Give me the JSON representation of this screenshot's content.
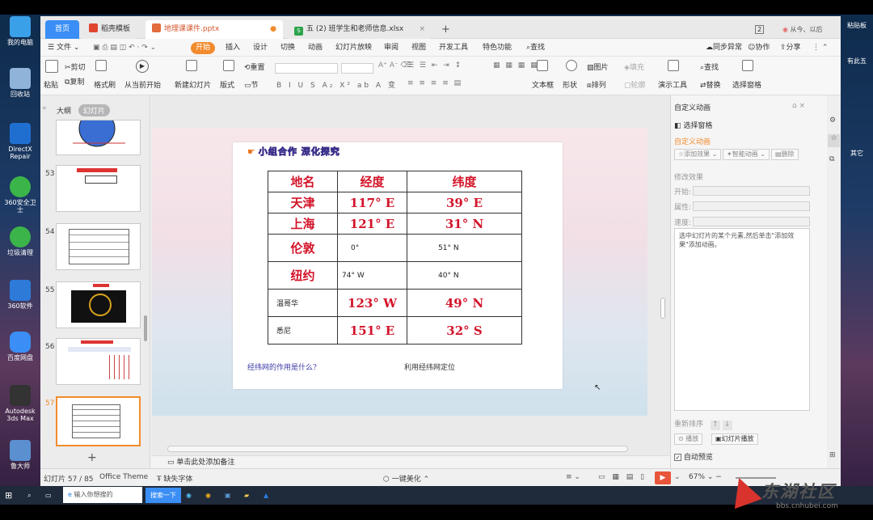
{
  "desktop": {
    "icons": [
      {
        "label": "我的电脑",
        "color": "#3aa0e8"
      },
      {
        "label": "回收站",
        "color": "#8fb3d9"
      },
      {
        "label": "DirectX Repair",
        "color": "#1f6fd1"
      },
      {
        "label": "360安全卫士",
        "color": "#3bb54a"
      },
      {
        "label": "垃圾清理",
        "color": "#3bb54a"
      },
      {
        "label": "360软件",
        "color": "#2d7ad8"
      },
      {
        "label": "百度网盘",
        "color": "#3a8ef5"
      },
      {
        "label": "Autodesk 3ds Max",
        "color": "#333333"
      },
      {
        "label": "鲁大师",
        "color": "#5a8fd0"
      }
    ],
    "right_items": [
      "粘贴板",
      "有此五",
      "其它"
    ]
  },
  "tabs": {
    "home": "首页",
    "template": "稻壳模板",
    "pptx": "地理课课件.pptx",
    "xlsx": "(2) 班学生和老师信息.xlsx",
    "xlsx_prefix": "五",
    "add": "+",
    "badge": "2",
    "user": "从今、以后"
  },
  "menu": {
    "file": "文件",
    "items": [
      "开始",
      "插入",
      "设计",
      "切换",
      "动画",
      "幻灯片放映",
      "审阅",
      "视图",
      "开发工具",
      "特色功能"
    ],
    "search": "查找",
    "sync": "同步异常",
    "collab": "协作",
    "share": "分享"
  },
  "ribbon": {
    "paste": "粘贴",
    "cut": "剪切",
    "copy": "复制",
    "format": "格式刷",
    "play_from": "从当前开始",
    "new_slide": "新建幻灯片",
    "layout": "版式",
    "reset": "重置",
    "section": "节",
    "textbox": "文本框",
    "shape": "形状",
    "picture": "图片",
    "arrange": "排列",
    "fill": "填充",
    "outline": "轮廓",
    "present_tools": "演示工具",
    "find": "查找",
    "replace": "替换",
    "select_pane": "选择窗格"
  },
  "left_panel": {
    "tab_outline": "大纲",
    "tab_slides": "幻灯片",
    "slide_numbers": [
      "53",
      "54",
      "55",
      "56",
      "57"
    ],
    "add": "+"
  },
  "slide": {
    "title": "小组合作 深化探究",
    "headers": [
      "地名",
      "经度",
      "纬度"
    ],
    "rows": [
      [
        "天津",
        "117° E",
        "39° E"
      ],
      [
        "上海",
        "121° E",
        "31° N"
      ],
      [
        "伦敦",
        "0°",
        "51° N"
      ],
      [
        "纽约",
        "74° W",
        "40° N"
      ],
      [
        "温哥华",
        "123° W",
        "49° N"
      ],
      [
        "悉尼",
        "151° E",
        "32° S"
      ]
    ],
    "question": "经纬网的作用是什么?",
    "answer": "利用经纬网定位"
  },
  "notes": {
    "placeholder": "单击此处添加备注"
  },
  "right_panel": {
    "title": "自定义动画",
    "select_pane": "选择窗格",
    "custom_anim": "自定义动画",
    "add_effect": "添加效果",
    "smart_anim": "智能动画",
    "delete": "删除",
    "modify": "修改效果",
    "start": "开始:",
    "property": "属性:",
    "speed": "速度:",
    "hint": "选中幻灯片的某个元素,然后单击\"添加效果\"添加动画。",
    "reorder": "重新排序",
    "play": "播放",
    "slideshow": "幻灯片播放",
    "auto_preview": "自动预览"
  },
  "status": {
    "slide_count": "幻灯片 57 / 85",
    "theme": "Office Theme",
    "font": "缺失字体",
    "beautify": "一键美化",
    "zoom": "67%"
  },
  "taskbar": {
    "search_placeholder": "输入你想搜的",
    "search_button": "搜索一下"
  },
  "watermark": {
    "text": "东湖社区",
    "url": "bbs.cnhubei.com"
  }
}
